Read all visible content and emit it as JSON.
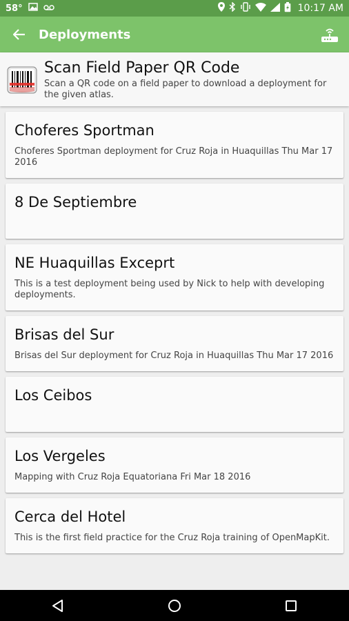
{
  "status_bar": {
    "temperature": "58°",
    "time": "10:17 AM"
  },
  "app_bar": {
    "title": "Deployments"
  },
  "scan": {
    "title": "Scan Field Paper QR Code",
    "subtitle": "Scan a QR code on a field paper to download a deployment for the given atlas."
  },
  "deployments": [
    {
      "title": "Choferes Sportman",
      "description": "Choferes Sportman deployment for Cruz Roja in Huaquillas Thu Mar 17 2016"
    },
    {
      "title": "8 De Septiembre",
      "description": ""
    },
    {
      "title": "NE Huaquillas Exceprt",
      "description": "This is a test deployment being used by Nick to help with developing deployments."
    },
    {
      "title": "Brisas del Sur",
      "description": "Brisas del Sur deployment for Cruz Roja in Huaquillas Thu Mar 17 2016"
    },
    {
      "title": "Los Ceibos",
      "description": ""
    },
    {
      "title": "Los Vergeles",
      "description": "Mapping with Cruz Roja Equatoriana Fri Mar 18 2016"
    },
    {
      "title": "Cerca del Hotel",
      "description": "This is the first field practice for the Cruz Roja training of OpenMapKit."
    }
  ],
  "icons": {
    "back": "arrow-left-icon",
    "router": "router-icon",
    "scan": "barcode-scanner-icon",
    "nav_back": "triangle-back-icon",
    "nav_home": "circle-home-icon",
    "nav_recents": "square-recents-icon"
  },
  "colors": {
    "status_bar": "#5b9d4a",
    "app_bar": "#7dc36a",
    "background": "#eeeeee",
    "card": "#fafafa",
    "nav_bar": "#000000"
  }
}
